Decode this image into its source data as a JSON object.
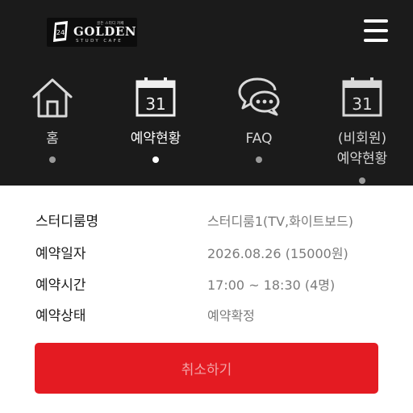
{
  "logo": {
    "badge_text": "24",
    "small_text": "골든 스터디 카페",
    "brand": "GOLDEN",
    "tagline": "STUDY CAFE"
  },
  "menu": {
    "icon": "hamburger-menu-icon"
  },
  "nav": {
    "items": [
      {
        "label": "홈",
        "icon": "home-icon",
        "active": false
      },
      {
        "label": "예약현황",
        "icon": "calendar-icon",
        "calendar_number": "31",
        "active": true
      },
      {
        "label": "FAQ",
        "icon": "speech-bubbles-icon",
        "active": false
      },
      {
        "label_line1": "(비회원)",
        "label_line2": "예약현황",
        "icon": "calendar-icon",
        "calendar_number": "31",
        "active": false
      }
    ]
  },
  "reservation": {
    "rows": [
      {
        "label": "스터디룸명",
        "value": "스터디룸1(TV,화이트보드)"
      },
      {
        "label": "예약일자",
        "value": "2026.08.26 (15000원)"
      },
      {
        "label": "예약시간",
        "value": "17:00 ~ 18:30 (4명)"
      },
      {
        "label": "예약상태",
        "value": "예약확정"
      }
    ],
    "cancel_label": "취소하기"
  },
  "colors": {
    "header_bg": "#1b1b1b",
    "accent": "#e41b22",
    "value_text": "#7b7b7b"
  }
}
